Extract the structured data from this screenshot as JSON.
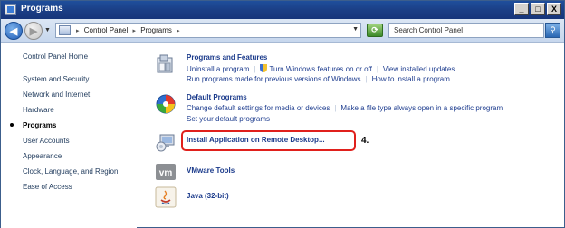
{
  "window": {
    "title": "Programs",
    "controls": {
      "minimize": "_",
      "maximize": "□",
      "close": "X"
    }
  },
  "address_bar": {
    "crumbs": [
      "Control Panel",
      "Programs"
    ],
    "search_placeholder": "Search Control Panel"
  },
  "sidebar": {
    "items": [
      {
        "label": "Control Panel Home",
        "active": false
      },
      {
        "label": "System and Security",
        "active": false
      },
      {
        "label": "Network and Internet",
        "active": false
      },
      {
        "label": "Hardware",
        "active": false
      },
      {
        "label": "Programs",
        "active": true
      },
      {
        "label": "User Accounts",
        "active": false
      },
      {
        "label": "Appearance",
        "active": false
      },
      {
        "label": "Clock, Language, and Region",
        "active": false
      },
      {
        "label": "Ease of Access",
        "active": false
      }
    ]
  },
  "main": {
    "programs_features": {
      "title": "Programs and Features",
      "links": {
        "uninstall": "Uninstall a program",
        "features": "Turn Windows features on or off",
        "updates": "View installed updates",
        "compat": "Run programs made for previous versions of Windows",
        "howto": "How to install a program"
      }
    },
    "default_programs": {
      "title": "Default Programs",
      "links": {
        "change_defaults": "Change default settings for media or devices",
        "filetype": "Make a file type always open in a specific program",
        "set_defaults": "Set your default programs"
      }
    },
    "install_remote": {
      "title": "Install Application on Remote Desktop..."
    },
    "vmware": {
      "title": "VMware Tools"
    },
    "java": {
      "title": "Java (32-bit)"
    }
  },
  "annotation": {
    "step": "4."
  }
}
